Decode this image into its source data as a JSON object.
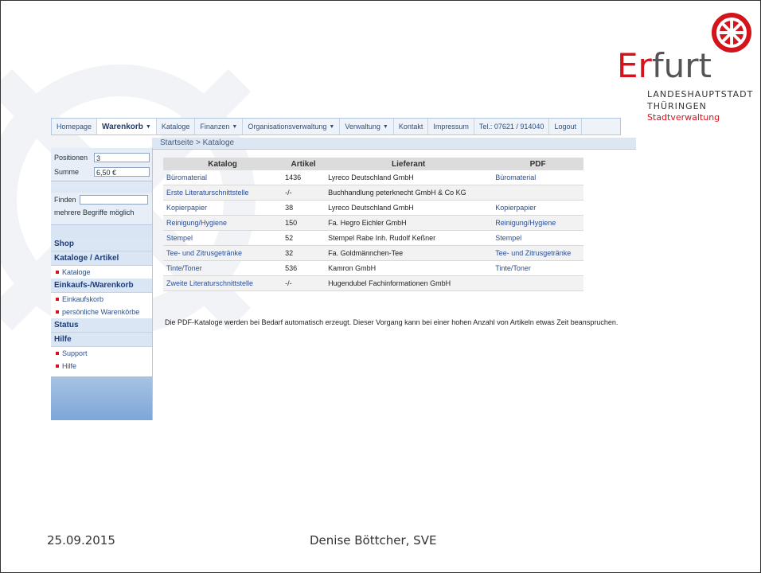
{
  "logo": {
    "word_red": "Er",
    "word_dark": "furt",
    "sub1": "LANDESHAUPTSTADT",
    "sub2": "THÜRINGEN",
    "sub3": "Stadtverwaltung"
  },
  "nav": {
    "items": [
      {
        "label": "Homepage",
        "dropdown": false,
        "active": false
      },
      {
        "label": "Warenkorb",
        "dropdown": true,
        "active": true
      },
      {
        "label": "Kataloge",
        "dropdown": false,
        "active": false
      },
      {
        "label": "Finanzen",
        "dropdown": true,
        "active": false
      },
      {
        "label": "Organisationsverwaltung",
        "dropdown": true,
        "active": false
      },
      {
        "label": "Verwaltung",
        "dropdown": true,
        "active": false
      },
      {
        "label": "Kontakt",
        "dropdown": false,
        "active": false
      },
      {
        "label": "Impressum",
        "dropdown": false,
        "active": false
      },
      {
        "label": "Tel.: 07621 / 914040",
        "dropdown": false,
        "active": false
      },
      {
        "label": "Logout",
        "dropdown": false,
        "active": false
      }
    ]
  },
  "breadcrumb": "Startseite > Kataloge",
  "sidebar": {
    "positionen_label": "Positionen",
    "positionen_value": "3",
    "summe_label": "Summe",
    "summe_value": "6,50 €",
    "finden_label": "Finden",
    "finden_value": "",
    "finden_hint": "mehrere Begriffe möglich",
    "shop": "Shop",
    "kataloge_artikel": "Kataloge / Artikel",
    "kataloge": "Kataloge",
    "einkauf_header": "Einkaufs-/Warenkorb",
    "einkaufskorb": "Einkaufskorb",
    "persoenliche": "persönliche Warenkörbe",
    "status": "Status",
    "hilfe_header": "Hilfe",
    "support": "Support",
    "hilfe": "Hilfe"
  },
  "table": {
    "headers": [
      "Katalog",
      "Artikel",
      "Lieferant",
      "PDF"
    ],
    "rows": [
      [
        "Büromaterial",
        "1436",
        "Lyreco Deutschland GmbH",
        "Büromaterial"
      ],
      [
        "Erste Literaturschnittstelle",
        "-/-",
        "Buchhandlung peterknecht GmbH & Co KG",
        ""
      ],
      [
        "Kopierpapier",
        "38",
        "Lyreco Deutschland GmbH",
        "Kopierpapier"
      ],
      [
        "Reinigung/Hygiene",
        "150",
        "Fa. Hegro Eichler GmbH",
        "Reinigung/Hygiene"
      ],
      [
        "Stempel",
        "52",
        "Stempel Rabe Inh. Rudolf Keßner",
        "Stempel"
      ],
      [
        "Tee- und Zitrusgetränke",
        "32",
        "Fa. Goldmännchen-Tee",
        "Tee- und Zitrusgetränke"
      ],
      [
        "Tinte/Toner",
        "536",
        "Kamron GmbH",
        "Tinte/Toner"
      ],
      [
        "Zweite Literaturschnittstelle",
        "-/-",
        "Hugendubel Fachinformationen GmbH",
        ""
      ]
    ]
  },
  "note": "Die PDF-Kataloge werden bei Bedarf automatisch erzeugt. Dieser Vorgang kann bei einer hohen Anzahl von Artikeln etwas Zeit beanspruchen.",
  "footer": {
    "date": "25.09.2015",
    "author": "Denise Böttcher, SVE"
  },
  "colors": {
    "accent_red": "#d4141b",
    "nav_blue": "#2f4f86",
    "link_blue": "#2a4e96"
  }
}
